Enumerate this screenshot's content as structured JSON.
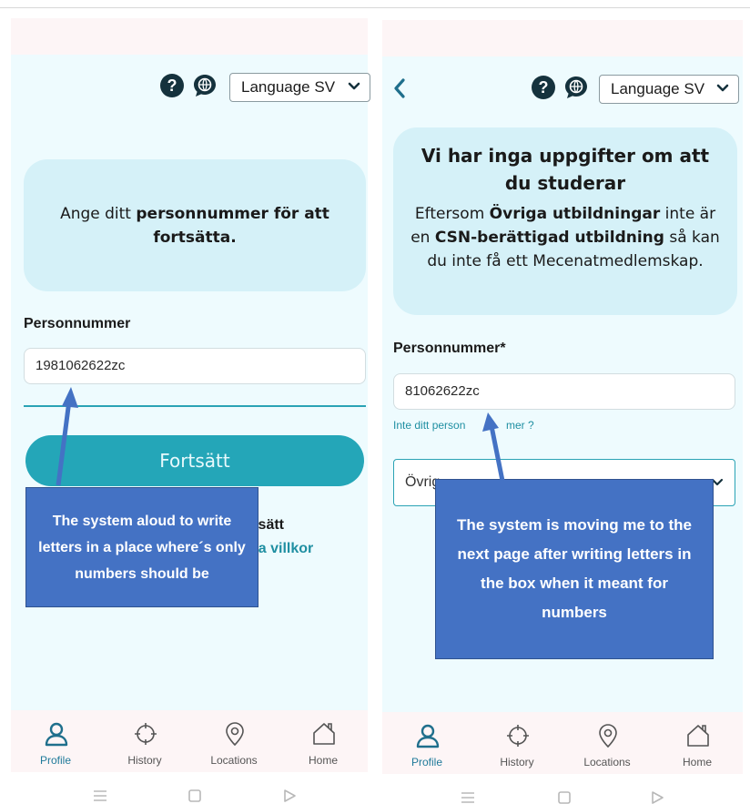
{
  "left": {
    "header": {
      "language_label": "Language SV"
    },
    "info_card": {
      "prefix": "Ange ditt ",
      "bold": "personnummer för att fortsätta."
    },
    "field": {
      "label": "Personnummer",
      "value": "1981062622zc"
    },
    "button": {
      "label": "Fortsätt"
    },
    "partial_text": "rtsätt",
    "partial_link": "na villkor",
    "annotation": "The system aloud to write letters in a place where´s only numbers should be"
  },
  "right": {
    "header": {
      "language_label": "Language SV"
    },
    "info_card": {
      "title": "Vi har inga uppgifter om att du studerar",
      "t1": "Eftersom ",
      "b1": "Övriga utbildningar",
      "t2": " inte är en ",
      "b2": "CSN-berättigad utbildning",
      "t3": " så kan du inte få ett Mecenatmedlemskap."
    },
    "field": {
      "label": "Personnummer*",
      "value": "81062622zc"
    },
    "link_left": "Inte ditt person",
    "link_right": "mer ?",
    "select_value": "Övrig",
    "annotation": "The system is moving me to the next page after writing letters in the box when it meant for numbers"
  },
  "bottom_nav": [
    {
      "label": "Profile",
      "icon": "person-icon"
    },
    {
      "label": "History",
      "icon": "crosshair-icon"
    },
    {
      "label": "Locations",
      "icon": "location-pin-icon"
    },
    {
      "label": "Home",
      "icon": "home-icon"
    }
  ],
  "colors": {
    "accent": "#24a6b8",
    "card": "#d5f1f8",
    "app_background": "#eefbfe",
    "annotation": "#4472c4",
    "dark_icon": "#15323d"
  }
}
